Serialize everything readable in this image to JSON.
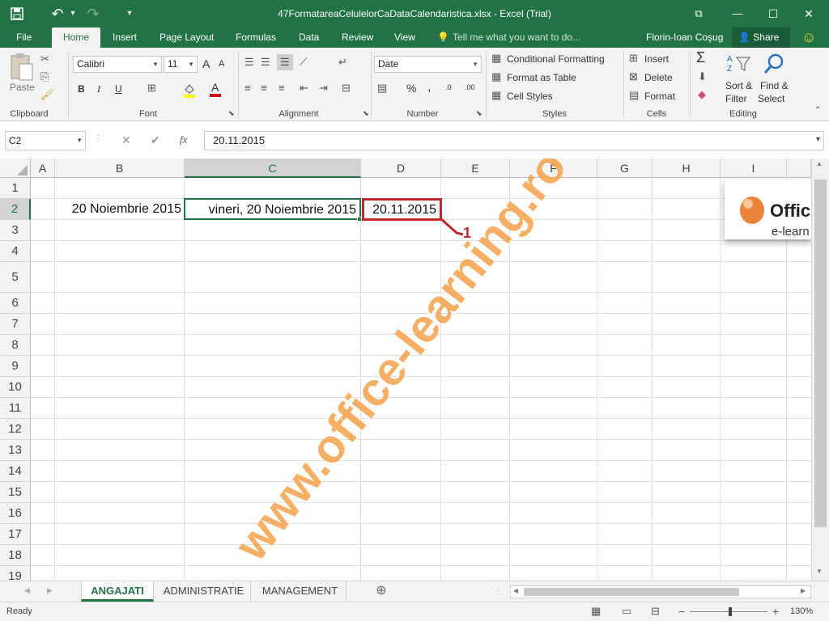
{
  "window": {
    "title": "47FormatareaCelulelorCaDataCalendaristica.xlsx - Excel (Trial)",
    "controls": {
      "restore_ribbon": "⧉",
      "minimize": "—",
      "maximize": "☐",
      "close": "✕"
    }
  },
  "qat": {
    "save_icon": "💾",
    "undo_icon": "↶",
    "redo_icon": "↷",
    "customize_icon": "▾"
  },
  "ribbon_tabs": [
    "File",
    "Home",
    "Insert",
    "Page Layout",
    "Formulas",
    "Data",
    "Review",
    "View"
  ],
  "tell_me": "Tell me what you want to do...",
  "user": {
    "name": "Florin-Ioan Coşug",
    "share": "Share",
    "smiley": "☺"
  },
  "groups": {
    "clipboard": {
      "label": "Clipboard",
      "paste": "Paste"
    },
    "font": {
      "label": "Font",
      "font_name": "Calibri",
      "font_size": "11",
      "bold": "B",
      "italic": "I",
      "underline": "U",
      "grow": "A",
      "shrink": "A"
    },
    "alignment": {
      "label": "Alignment"
    },
    "number": {
      "label": "Number",
      "format": "Date",
      "currency": "$",
      "percent": "%",
      "comma": ",",
      "inc_dec": ".0",
      "dec_dec": ".00"
    },
    "styles": {
      "label": "Styles",
      "conditional": "Conditional Formatting",
      "format_table": "Format as Table",
      "cell_styles": "Cell Styles"
    },
    "cells": {
      "label": "Cells",
      "insert": "Insert",
      "delete": "Delete",
      "format": "Format"
    },
    "editing": {
      "label": "Editing",
      "sum": "Σ",
      "sort_filter_1": "Sort &",
      "sort_filter_2": "Filter",
      "find_select_1": "Find &",
      "find_select_2": "Select"
    }
  },
  "formula_bar": {
    "name_box": "C2",
    "cancel": "✕",
    "enter": "✔",
    "fx": "fx",
    "value": "20.11.2015"
  },
  "columns": [
    "A",
    "B",
    "C",
    "D",
    "E",
    "F",
    "G",
    "H",
    "I"
  ],
  "rows": [
    "1",
    "2",
    "3",
    "4",
    "5",
    "6",
    "7",
    "8",
    "9",
    "10",
    "11",
    "12",
    "13",
    "14",
    "15",
    "16",
    "17",
    "18",
    "19"
  ],
  "cells": {
    "B2": "20 Noiembrie 2015",
    "C2": "vineri, 20 Noiembrie 2015",
    "D2": "20.11.2015"
  },
  "annotation": {
    "label": "1",
    "color": "#c0282e"
  },
  "watermark": {
    "text": "www.office-learning.ro",
    "color": "#f5a24b"
  },
  "logo": {
    "line1": "Offic",
    "line2": "e-learn"
  },
  "sheets": {
    "active": "ANGAJATI",
    "others": [
      "ADMINISTRATIE",
      "MANAGEMENT"
    ],
    "add": "⊕"
  },
  "status": {
    "ready": "Ready",
    "zoom": "130%",
    "minus": "−",
    "plus": "+"
  },
  "colors": {
    "accent": "#217346",
    "ribbon_bg": "#f3f3f3"
  }
}
